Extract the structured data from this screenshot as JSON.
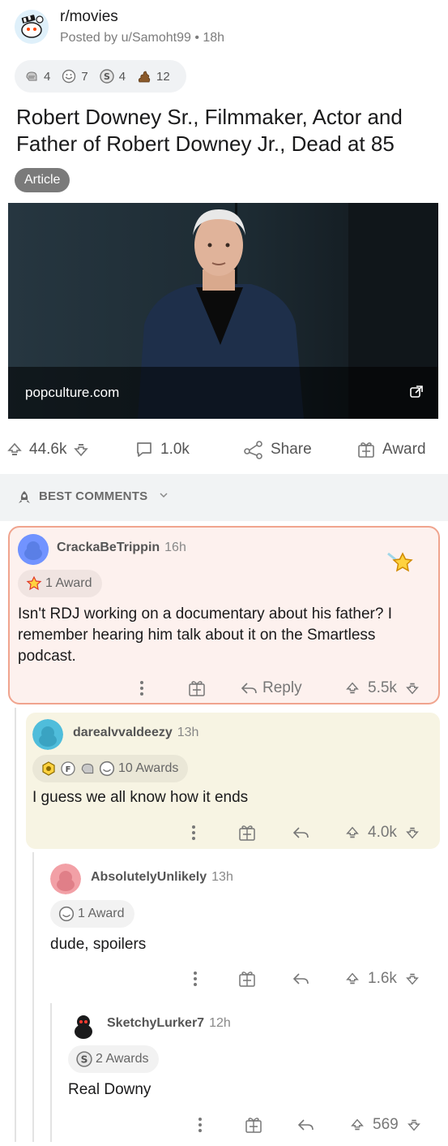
{
  "post": {
    "subreddit": "r/movies",
    "meta": "Posted by u/Samoht99 • 18h",
    "awards": [
      {
        "icon": "praise-icon",
        "count": "4"
      },
      {
        "icon": "wholesome-icon",
        "count": "7"
      },
      {
        "icon": "silver-coin-icon",
        "count": "4"
      },
      {
        "icon": "poop-icon",
        "count": "12"
      }
    ],
    "title": "Robert Downey Sr., Filmmaker, Actor and Father of Robert Downey Jr., Dead at 85",
    "flair": "Article",
    "link_domain": "popculture.com",
    "upvotes": "44.6k",
    "comments": "1.0k",
    "share_label": "Share",
    "award_label": "Award"
  },
  "sort": {
    "label": "BEST COMMENTS"
  },
  "comments": [
    {
      "user": "CrackaBeTrippin",
      "time": "16h",
      "awards_text": "1 Award",
      "body": "Isn't RDJ working on a documentary about his father? I remember hearing him talk about it on the Smartless podcast.",
      "reply_label": "Reply",
      "score": "5.5k",
      "highlight_color": "#fdf1ee",
      "border_color": "#f0a48e"
    },
    {
      "user": "darealvvaldeezy",
      "time": "13h",
      "awards_text": "10 Awards",
      "body": "I guess we all know how it ends",
      "score": "4.0k",
      "highlight_color": "#f7f4e3"
    },
    {
      "user": "AbsolutelyUnlikely",
      "time": "13h",
      "awards_text": "1 Award",
      "body": "dude, spoilers",
      "score": "1.6k"
    },
    {
      "user": "SketchyLurker7",
      "time": "12h",
      "awards_text": "2 Awards",
      "body": "Real Downy",
      "score": "569"
    }
  ]
}
